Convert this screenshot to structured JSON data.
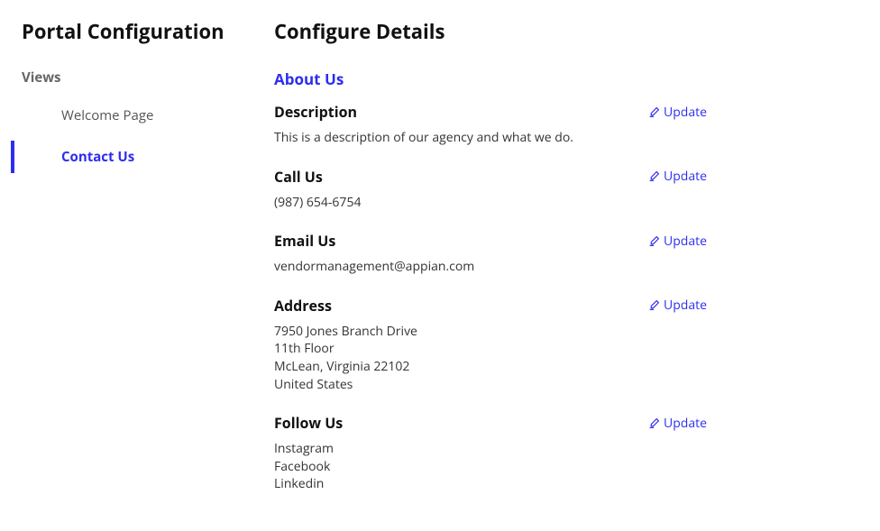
{
  "sidebar": {
    "title": "Portal Configuration",
    "views_heading": "Views",
    "items": [
      {
        "label": "Welcome Page",
        "active": false
      },
      {
        "label": "Contact Us",
        "active": true
      }
    ]
  },
  "main": {
    "title": "Configure Details",
    "section_heading": "About Us",
    "update_label": "Update",
    "blocks": {
      "description": {
        "label": "Description",
        "value": "This is a description of our agency and what we do."
      },
      "call_us": {
        "label": "Call Us",
        "value": "(987) 654-6754"
      },
      "email_us": {
        "label": "Email Us",
        "value": "vendormanagement@appian.com"
      },
      "address": {
        "label": "Address",
        "lines": [
          "7950 Jones Branch Drive",
          "11th Floor",
          "McLean, Virginia 22102",
          "United States"
        ]
      },
      "follow_us": {
        "label": "Follow Us",
        "lines": [
          "Instagram",
          "Facebook",
          "Linkedin"
        ]
      }
    }
  }
}
